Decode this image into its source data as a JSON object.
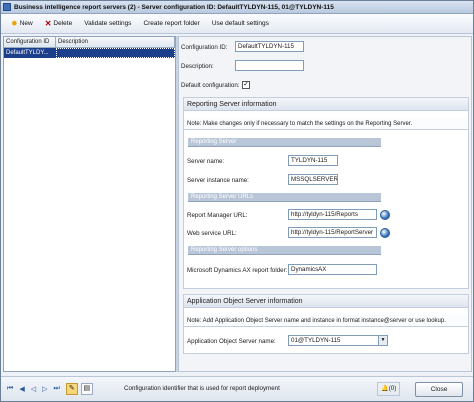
{
  "window": {
    "title": "Business intelligence report servers (2) - Server configuration ID: DefaultTYLDYN-115, 01@TYLDYN-115"
  },
  "toolbar": {
    "new_label": "New",
    "delete_label": "Delete",
    "validate_label": "Validate settings",
    "create_folder_label": "Create report folder",
    "use_default_label": "Use default settings"
  },
  "grid": {
    "headers": [
      "Configuration ID",
      "Description"
    ],
    "rows": [
      {
        "config_id": "DefaultTYLDY...",
        "description": ""
      }
    ]
  },
  "form": {
    "config_id_label": "Configuration ID:",
    "config_id_value": "DefaultTYLDYN-115",
    "description_label": "Description:",
    "description_value": "",
    "default_config_label": "Default configuration:",
    "default_config_checked": true,
    "reporting_section": {
      "title": "Reporting Server information",
      "note": "Note: Make changes only if necessary to match the settings on the Reporting Server.",
      "group_server": "Reporting Server",
      "server_name_label": "Server name:",
      "server_name_value": "TYLDYN-115",
      "instance_label": "Server instance name:",
      "instance_value": "MSSQLSERVER",
      "group_urls": "Reporting Server URLs",
      "manager_url_label": "Report Manager URL:",
      "manager_url_value": "http://tyldyn-115/Reports",
      "ws_url_label": "Web service URL:",
      "ws_url_value": "http://tyldyn-115/ReportServer",
      "group_options": "Reporting Server options",
      "folder_label": "Microsoft Dynamics AX report folder:",
      "folder_value": "DynamicsAX"
    },
    "aos_section": {
      "title": "Application Object Server information",
      "note": "Note: Add Application Object Server name and instance in format instance@server or use lookup.",
      "aos_name_label": "Application Object Server name:",
      "aos_name_value": "01@TYLDYN-115"
    }
  },
  "statusbar": {
    "nav_first": "⏮",
    "nav_prev_page": "◀",
    "nav_prev": "◁",
    "nav_next": "▷",
    "nav_last": "⏭",
    "tool_edit": "✎",
    "tool_notes": "▤",
    "help_text": "Configuration identifier that is used for report deployment",
    "notification_count": "(0)",
    "close_label": "Close"
  }
}
